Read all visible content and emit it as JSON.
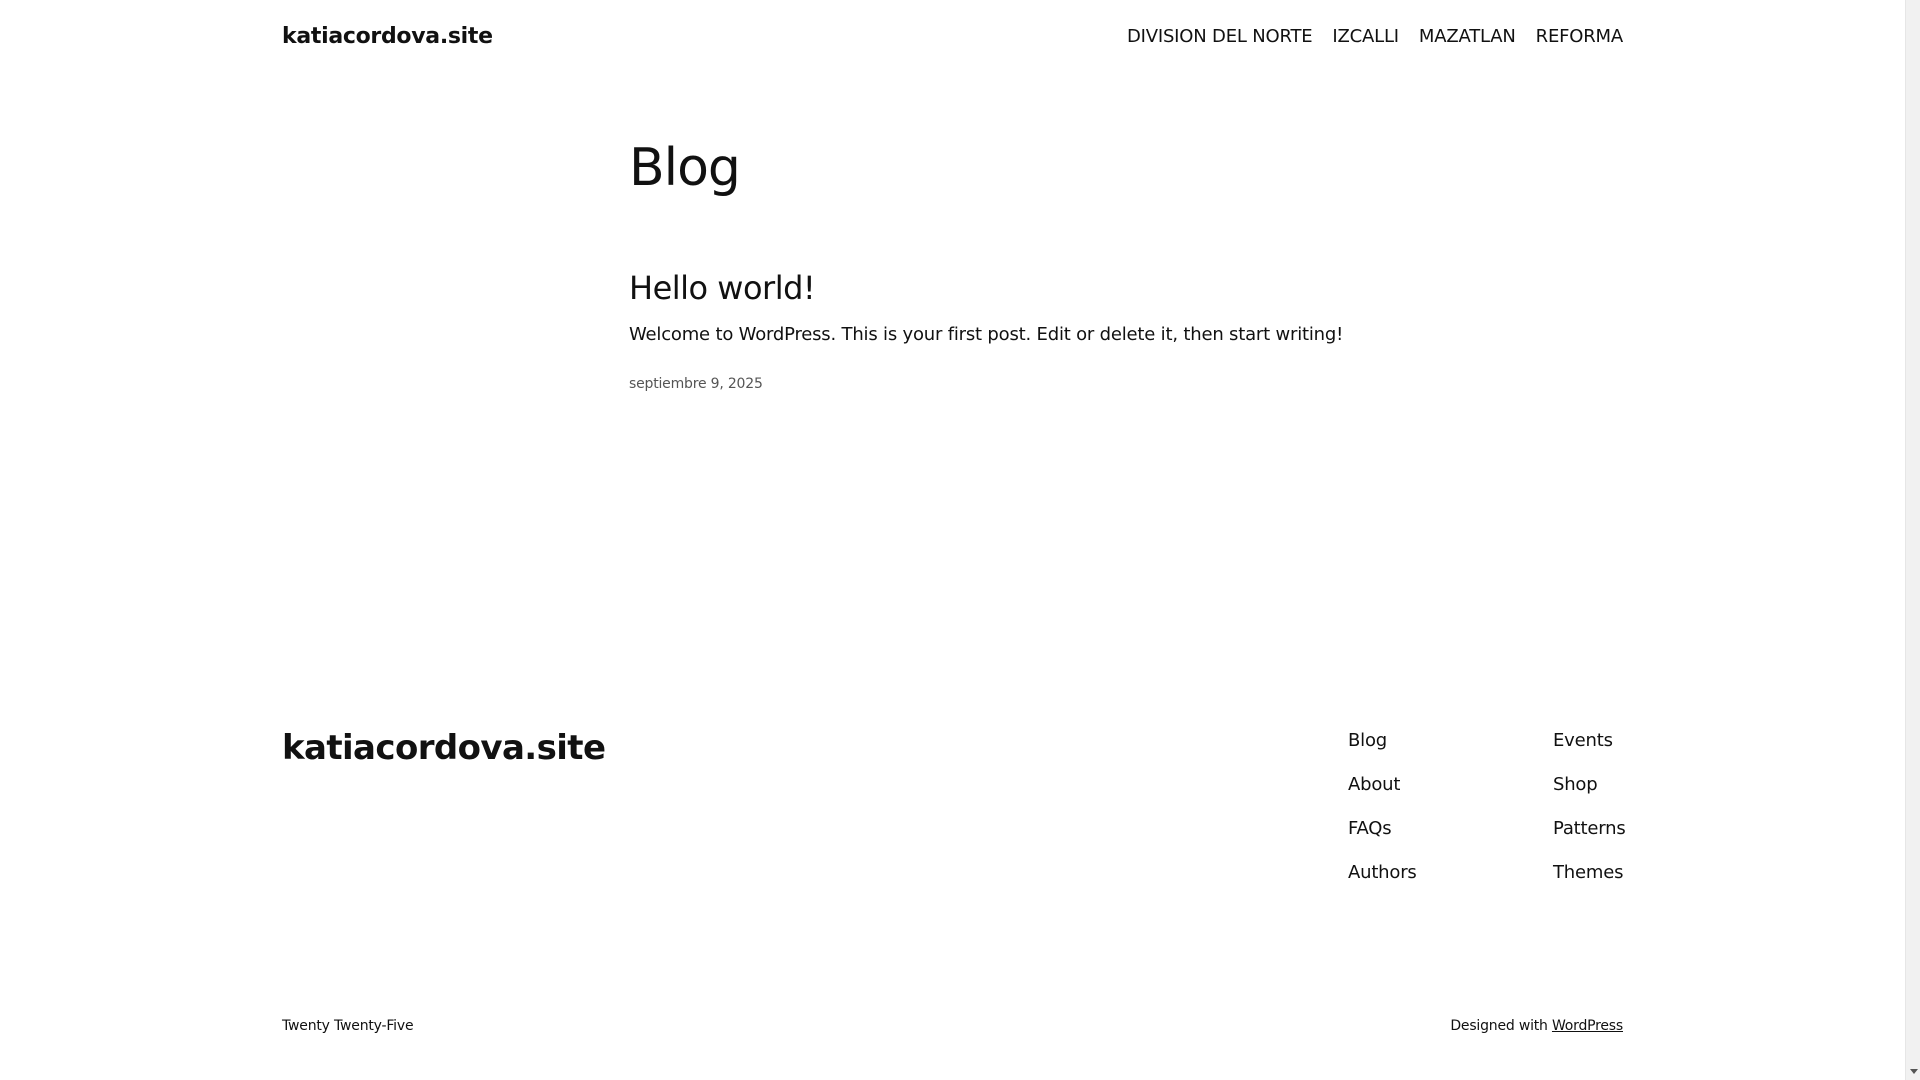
{
  "header": {
    "site_title": "katiacordova.site",
    "nav": [
      "DIVISION DEL NORTE",
      "IZCALLI",
      "MAZATLAN",
      "REFORMA"
    ]
  },
  "main": {
    "heading": "Blog",
    "post": {
      "title": "Hello world!",
      "excerpt": "Welcome to WordPress. This is your first post. Edit or delete it, then start writing!",
      "date": "septiembre 9, 2025"
    }
  },
  "footer": {
    "site_title": "katiacordova.site",
    "col1": [
      "Blog",
      "About",
      "FAQs",
      "Authors"
    ],
    "col2": [
      "Events",
      "Shop",
      "Patterns",
      "Themes"
    ],
    "theme_credit": "Twenty Twenty-Five",
    "designed_with": "Designed with",
    "designed_with_link": "WordPress"
  },
  "scrollbar": {
    "icon": "chevron-down-icon"
  }
}
